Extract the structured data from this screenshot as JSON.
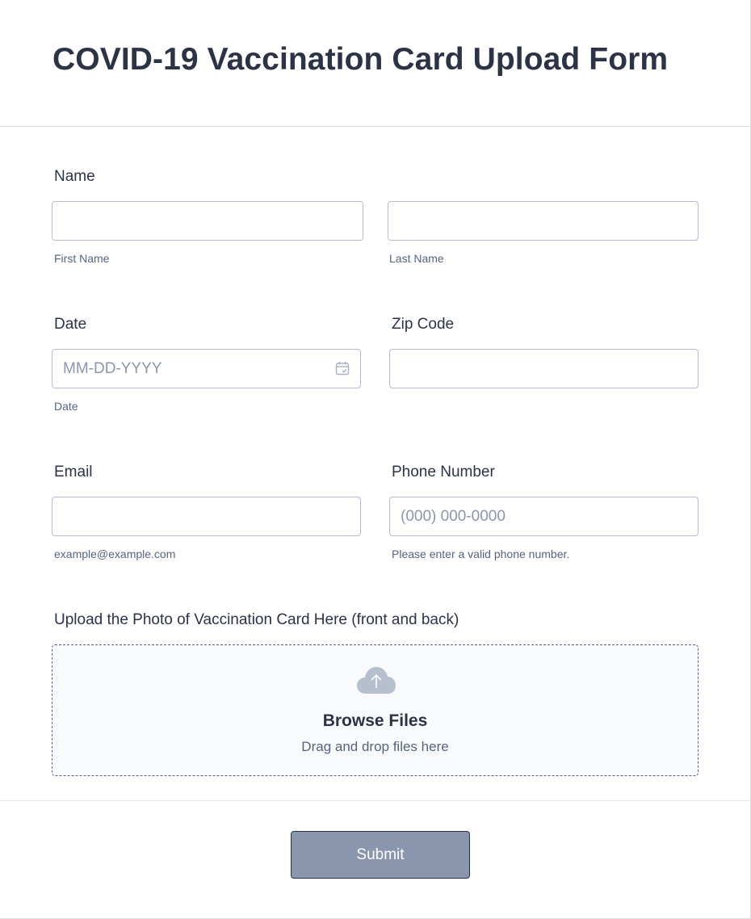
{
  "form": {
    "title": "COVID-19 Vaccination Card Upload Form"
  },
  "name": {
    "label": "Name",
    "first": {
      "value": "",
      "sublabel": "First Name"
    },
    "last": {
      "value": "",
      "sublabel": "Last Name"
    }
  },
  "date": {
    "label": "Date",
    "placeholder": "MM-DD-YYYY",
    "value": "",
    "sublabel": "Date",
    "icon": "calendar-icon"
  },
  "zip": {
    "label": "Zip Code",
    "value": ""
  },
  "email": {
    "label": "Email",
    "value": "",
    "sublabel": "example@example.com"
  },
  "phone": {
    "label": "Phone Number",
    "placeholder": "(000) 000-0000",
    "value": "",
    "sublabel": "Please enter a valid phone number."
  },
  "upload": {
    "label": "Upload the Photo of Vaccination Card Here (front and back)",
    "icon": "cloud-upload-icon",
    "browse_label": "Browse Files",
    "drag_text": "Drag and drop files here"
  },
  "submit": {
    "label": "Submit"
  },
  "colors": {
    "text": "#2c3345",
    "subtext": "#57647e",
    "submit_bg": "#8a96ad",
    "border": "#b8bdc9"
  }
}
